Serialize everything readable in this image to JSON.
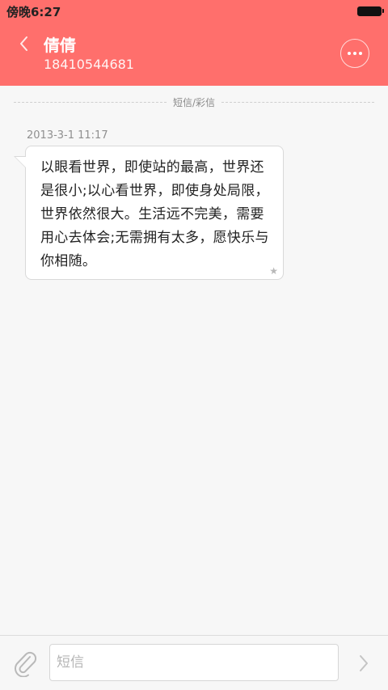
{
  "status_bar": {
    "time": "傍晚6:27"
  },
  "header": {
    "contact_name": "倩倩",
    "contact_number": "18410544681",
    "back_icon": "chevron-left-icon",
    "more_icon": "more-dots-icon"
  },
  "thread": {
    "type_label": "短信/彩信",
    "messages": [
      {
        "timestamp": "2013-3-1 11:17",
        "text": "以眼看世界，即使站的最高，世界还是很小;以心看世界，即使身处局限，世界依然很大。生活远不完美，需要用心去体会;无需拥有太多，愿快乐与你相随。",
        "star": "★"
      }
    ]
  },
  "composer": {
    "placeholder": "短信",
    "value": "",
    "attach_icon": "paperclip-icon",
    "send_icon": "chevron-right-icon"
  },
  "colors": {
    "header_bg": "#ff6f6c",
    "page_bg": "#f7f7f7"
  }
}
